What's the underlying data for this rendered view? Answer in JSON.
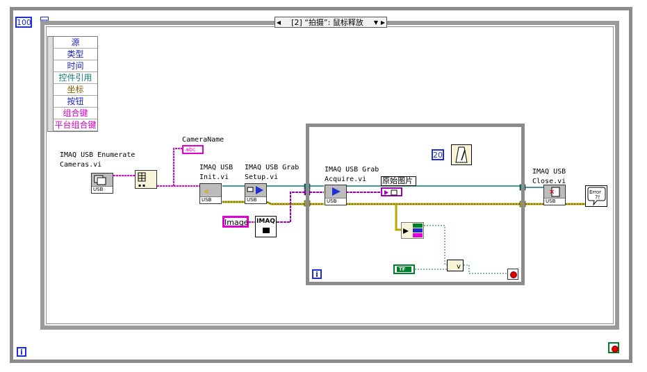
{
  "iteration_count_const": "100",
  "case_selector": {
    "left_arrow": "◀",
    "right_arrow": "▶",
    "dropdown": "▼",
    "text": "[2] “拍摄”: 鼠标释放"
  },
  "event_data_items": [
    {
      "label": "源",
      "color": "#1b24c9"
    },
    {
      "label": "类型",
      "color": "#1b24c9"
    },
    {
      "label": "时间",
      "color": "#1b24c9"
    },
    {
      "label": "控件引用",
      "color": "#0f7a7a"
    },
    {
      "label": "坐标",
      "color": "#8a5a00"
    },
    {
      "label": "按钮",
      "color": "#1b24c9"
    },
    {
      "label": "组合键",
      "color": "#d400c8"
    },
    {
      "label": "平台组合键",
      "color": "#d400c8"
    }
  ],
  "nodes": {
    "enumerate": {
      "label_line1": "IMAQ USB Enumerate",
      "label_line2": "Cameras.vi",
      "tag": "USB"
    },
    "init": {
      "label_line1": "IMAQ USB",
      "label_line2": "Init.vi",
      "tag": "USB"
    },
    "grab_setup": {
      "label_line1": "IMAQ USB Grab",
      "label_line2": "Setup.vi",
      "tag": "USB"
    },
    "grab_acquire": {
      "label_line1": "IMAQ USB Grab",
      "label_line2": "Acquire.vi",
      "tag": "USB"
    },
    "close": {
      "label_line1": "IMAQ USB",
      "label_line2": "Close.vi",
      "tag": "USB"
    },
    "error_handler": "Error"
  },
  "camera_name_label": "CameraName",
  "camera_name_indicator": "abc",
  "image_const": "Image",
  "imaq_create": "IMAQ",
  "wait_const": "20",
  "raw_image_label": "原始图片",
  "bool_const": "TF",
  "loop_index": "i",
  "outer_index": "i",
  "colors": {
    "string_wire": "#e000d6",
    "refnum_wire": "#007a7a",
    "error_wire": "#b8a800",
    "bool_wire": "#00802b",
    "structure_border": "#8c8c8c",
    "numeric_blue": "#1e2fd0"
  }
}
